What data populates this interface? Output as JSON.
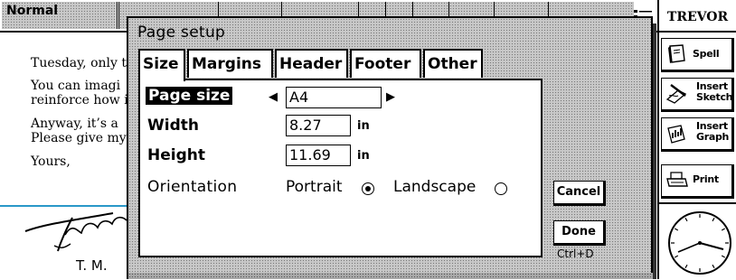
{
  "toolbar": {
    "style_name": "Normal"
  },
  "document": {
    "lines": [
      "Tuesday, only t",
      "You can imagi",
      "reinforce how i",
      "Anyway, it’s a",
      "Please give my",
      "Yours,"
    ],
    "sender_name": "T. M."
  },
  "sidebar": {
    "title": "TREVOR",
    "buttons": [
      {
        "label": "Spell",
        "icon": "spell-book-icon"
      },
      {
        "label": "Insert Sketch",
        "icon": "pen-sketch-icon"
      },
      {
        "label": "Insert Graph",
        "icon": "graph-book-icon"
      },
      {
        "label": "Print",
        "icon": "printer-icon"
      }
    ],
    "clock_icon": "analog-clock-icon"
  },
  "dialog": {
    "title": "Page setup",
    "tabs": [
      {
        "label": "Size",
        "active": true
      },
      {
        "label": "Margins",
        "active": false
      },
      {
        "label": "Header",
        "active": false
      },
      {
        "label": "Footer",
        "active": false
      },
      {
        "label": "Other",
        "active": false
      }
    ],
    "fields": {
      "page_size": {
        "label": "Page size",
        "value": "A4"
      },
      "width": {
        "label": "Width",
        "value": "8.27",
        "unit": "in"
      },
      "height": {
        "label": "Height",
        "value": "11.69",
        "unit": "in"
      },
      "orientation": {
        "label": "Orientation",
        "options": [
          {
            "label": "Portrait",
            "selected": true
          },
          {
            "label": "Landscape",
            "selected": false
          }
        ]
      }
    },
    "buttons": {
      "cancel": "Cancel",
      "done": "Done",
      "done_shortcut": "Ctrl+D"
    }
  },
  "colors": {
    "selection_line": "#2a98c8",
    "dither": "#c8c8c8"
  }
}
